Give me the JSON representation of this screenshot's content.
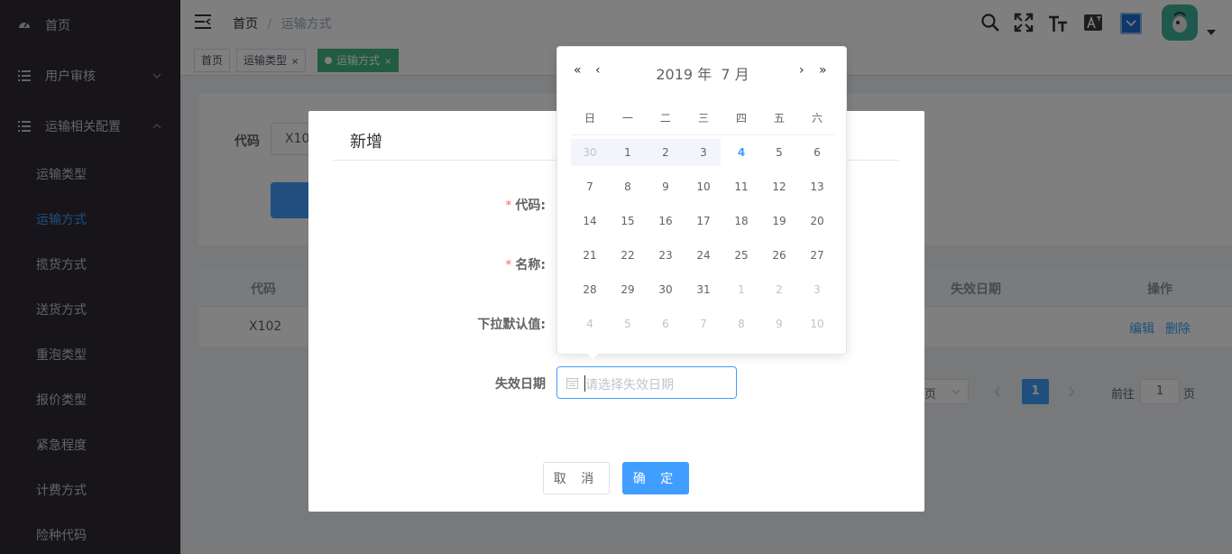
{
  "sidebar": {
    "items": [
      {
        "label": "首页",
        "icon": "dashboard-icon"
      },
      {
        "label": "用户审核",
        "icon": "list-icon"
      },
      {
        "label": "运输相关配置",
        "icon": "list-icon"
      }
    ],
    "sub_items": [
      "运输类型",
      "运输方式",
      "揽货方式",
      "送货方式",
      "重泡类型",
      "报价类型",
      "紧急程度",
      "计费方式",
      "险种代码"
    ],
    "active_sub": "运输方式"
  },
  "breadcrumb": {
    "home": "首页",
    "sep": "/",
    "current": "运输方式"
  },
  "tags": [
    {
      "label": "首页",
      "close": ""
    },
    {
      "label": "运输类型",
      "close": "×"
    },
    {
      "label": "运输方式",
      "close": "×"
    }
  ],
  "background": {
    "search_label": "代码",
    "search_value": "X10",
    "table_headers": {
      "code": "代码",
      "expire": "失效日期",
      "ops": "操作"
    },
    "row": {
      "code": "X102",
      "edit": "编辑",
      "delete": "删除"
    },
    "pagination": {
      "per_page_suffix": "页",
      "current_page": "1",
      "goto_label": "前往",
      "goto_value": "1",
      "goto_suffix": "页"
    }
  },
  "dialog": {
    "title": "新增",
    "fields": {
      "code_label": "代码:",
      "name_label": "名称:",
      "default_label": "下拉默认值:",
      "expire_label": "失效日期",
      "expire_placeholder": "请选择失效日期",
      "required_mark": "*"
    },
    "cancel": "取 消",
    "confirm": "确 定"
  },
  "datepicker": {
    "header": "2019 年  7 月",
    "prev_year": "«",
    "prev_month": "‹",
    "next_month": "›",
    "next_year": "»",
    "weekdays": [
      "日",
      "一",
      "二",
      "三",
      "四",
      "五",
      "六"
    ],
    "weeks": [
      [
        "30",
        "1",
        "2",
        "3",
        "4",
        "5",
        "6"
      ],
      [
        "7",
        "8",
        "9",
        "10",
        "11",
        "12",
        "13"
      ],
      [
        "14",
        "15",
        "16",
        "17",
        "18",
        "19",
        "20"
      ],
      [
        "21",
        "22",
        "23",
        "24",
        "25",
        "26",
        "27"
      ],
      [
        "28",
        "29",
        "30",
        "31",
        "1",
        "2",
        "3"
      ],
      [
        "4",
        "5",
        "6",
        "7",
        "8",
        "9",
        "10"
      ]
    ],
    "today": "4"
  },
  "colors": {
    "accent": "#409eff",
    "tag_active": "#42b983",
    "sidebar_bg": "#2e2b33",
    "avatar_bg": "#3fb39a"
  }
}
